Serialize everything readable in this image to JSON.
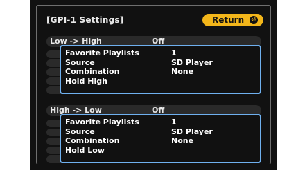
{
  "settings": {
    "title": "[GPI-1 Settings]",
    "return_label": "Return",
    "return_icon": "enter-icon",
    "accent_color": "#f3b61a",
    "highlight_color": "#6fb0ef",
    "sections": [
      {
        "label": "Low -> High",
        "value": "Off",
        "rows": [
          {
            "key": "Favorite Playlists",
            "value": "1"
          },
          {
            "key": "Source",
            "value": "SD Player"
          },
          {
            "key": "Combination",
            "value": "None"
          },
          {
            "key": "Hold High",
            "value": ""
          }
        ]
      },
      {
        "label": "High -> Low",
        "value": "Off",
        "rows": [
          {
            "key": "Favorite Playlists",
            "value": "1"
          },
          {
            "key": "Source",
            "value": "SD Player"
          },
          {
            "key": "Combination",
            "value": "None"
          },
          {
            "key": "Hold Low",
            "value": ""
          }
        ]
      }
    ]
  }
}
